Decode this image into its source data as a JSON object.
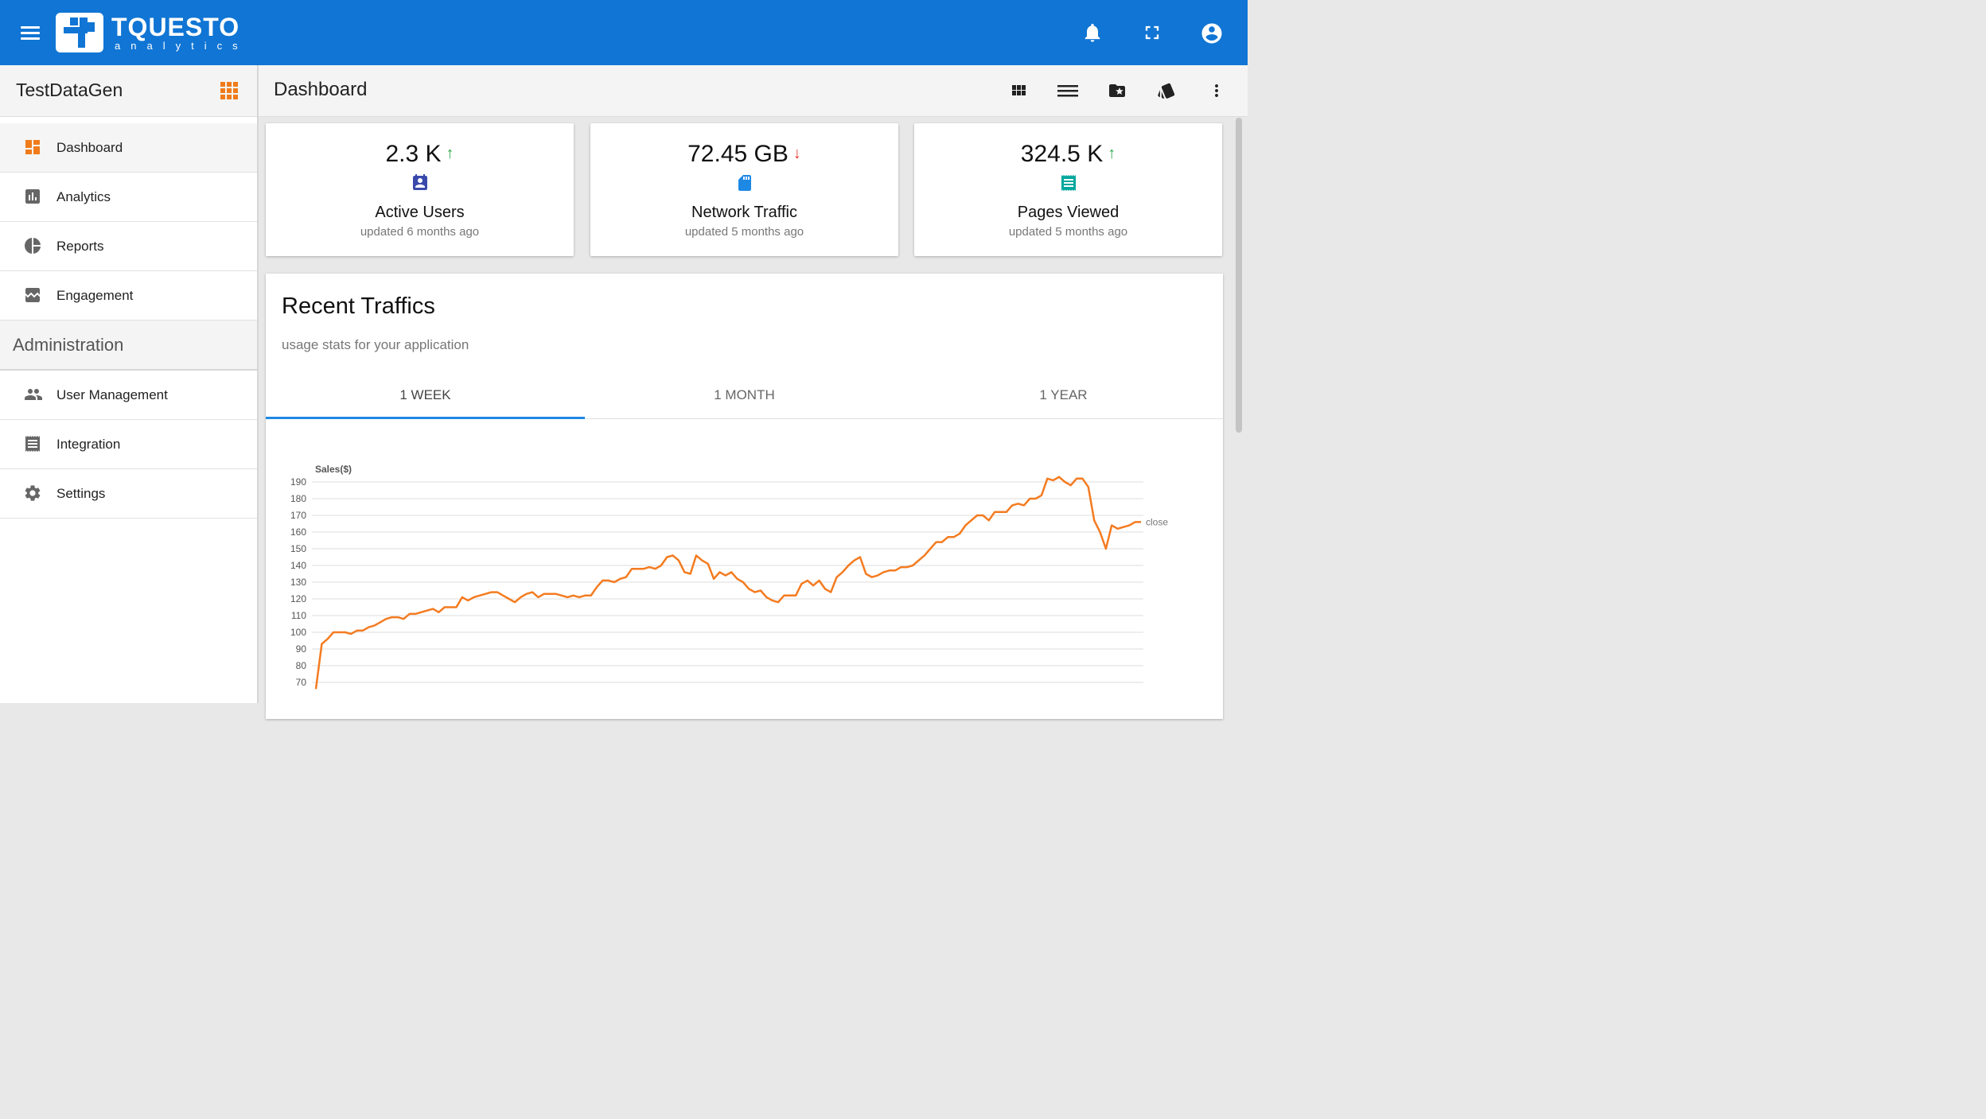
{
  "app": {
    "logo_main": "TQUESTO",
    "logo_sub": "analytics",
    "sidebar_title": "TestDataGen",
    "page_title": "Dashboard"
  },
  "sidebar": {
    "items": [
      {
        "label": "Dashboard",
        "icon": "dashboard-icon"
      },
      {
        "label": "Analytics",
        "icon": "analytics-icon"
      },
      {
        "label": "Reports",
        "icon": "pie-chart-icon"
      },
      {
        "label": "Engagement",
        "icon": "engagement-icon"
      }
    ],
    "section_title": "Administration",
    "admin_items": [
      {
        "label": "User Management",
        "icon": "people-icon"
      },
      {
        "label": "Integration",
        "icon": "receipt-icon"
      },
      {
        "label": "Settings",
        "icon": "gear-icon"
      }
    ]
  },
  "stats": [
    {
      "value": "2.3 K",
      "trend": "up",
      "label": "Active Users",
      "updated": "updated 6 months ago",
      "icon": "contact-icon",
      "icon_color": "#3949ab"
    },
    {
      "value": "72.45 GB",
      "trend": "down",
      "label": "Network Traffic",
      "updated": "updated 5 months ago",
      "icon": "sd-card-icon",
      "icon_color": "#1e88e5"
    },
    {
      "value": "324.5 K",
      "trend": "up",
      "label": "Pages Viewed",
      "updated": "updated 5 months ago",
      "icon": "receipt-icon",
      "icon_color": "#00a79d"
    }
  ],
  "colors": {
    "topbar": "#1075d4",
    "accent_orange": "#f07b1a",
    "trend_up": "#2eaa4a",
    "trend_down": "#e53935",
    "tab_ink": "#1e88e5"
  },
  "traffic": {
    "title": "Recent Traffics",
    "subtitle": "usage stats for your application",
    "tabs": [
      "1 WEEK",
      "1 MONTH",
      "1 YEAR"
    ],
    "active_tab": 0
  },
  "chart_data": {
    "type": "line",
    "ylabel": "Sales($)",
    "ylim": [
      65,
      192
    ],
    "yticks": [
      190,
      180,
      170,
      160,
      150,
      140,
      130,
      120,
      110,
      100,
      90,
      80,
      70
    ],
    "series": [
      {
        "name": "close",
        "color": "#f47b20",
        "values": [
          66,
          93,
          96,
          100,
          100,
          100,
          99,
          101,
          101,
          103,
          104,
          106,
          108,
          109,
          109,
          108,
          111,
          111,
          112,
          113,
          114,
          112,
          115,
          115,
          115,
          121,
          119,
          121,
          122,
          123,
          124,
          124,
          122,
          120,
          118,
          121,
          123,
          124,
          121,
          123,
          123,
          123,
          122,
          121,
          122,
          121,
          122,
          122,
          127,
          131,
          131,
          130,
          132,
          133,
          138,
          138,
          138,
          139,
          138,
          140,
          145,
          146,
          143,
          136,
          135,
          146,
          143,
          141,
          132,
          136,
          134,
          136,
          132,
          130,
          126,
          124,
          125,
          121,
          119,
          118,
          122,
          122,
          122,
          129,
          131,
          128,
          131,
          126,
          124,
          133,
          136,
          140,
          143,
          145,
          135,
          133,
          134,
          136,
          137,
          137,
          139,
          139,
          140,
          143,
          146,
          150,
          154,
          154,
          157,
          157,
          159,
          164,
          167,
          170,
          170,
          167,
          172,
          172,
          172,
          176,
          177,
          176,
          180,
          180,
          182,
          192,
          191,
          193,
          190,
          188,
          192,
          192,
          187,
          167,
          160,
          150,
          164,
          162,
          163,
          164,
          166,
          166
        ]
      }
    ]
  }
}
